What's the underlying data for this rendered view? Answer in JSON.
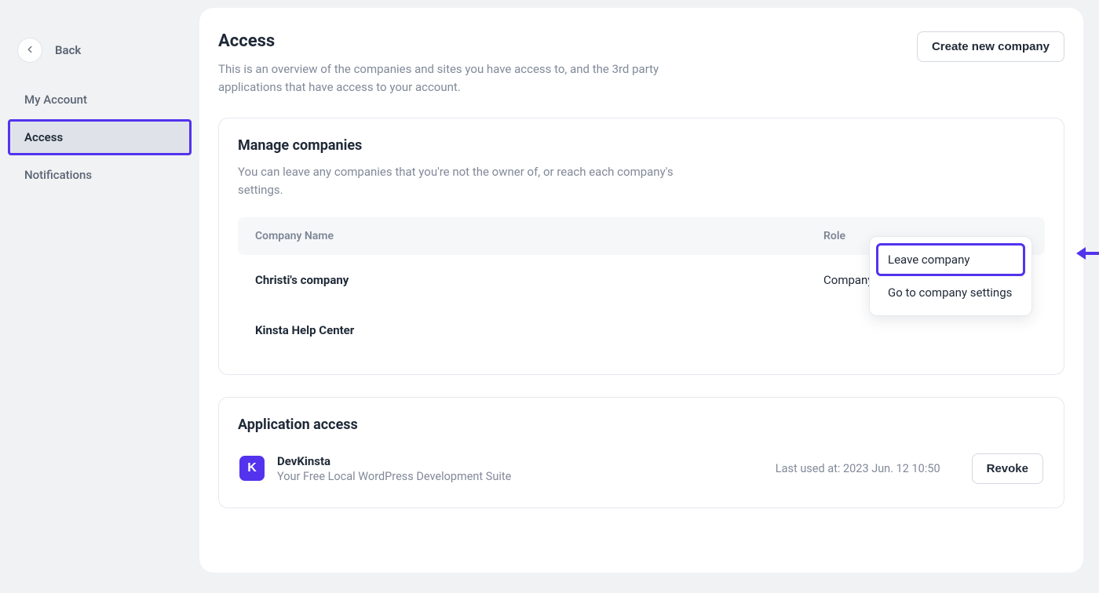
{
  "sidebar": {
    "back_label": "Back",
    "items": [
      {
        "label": "My Account"
      },
      {
        "label": "Access"
      },
      {
        "label": "Notifications"
      }
    ],
    "active_index": 1
  },
  "page": {
    "title": "Access",
    "subtitle": "This is an overview of the companies and sites you have access to, and the 3rd party applications that have access to your account.",
    "create_button": "Create new company"
  },
  "manage_companies": {
    "title": "Manage companies",
    "description": "You can leave any companies that you're not the owner of, or reach each company's settings.",
    "columns": {
      "name": "Company Name",
      "role": "Role"
    },
    "rows": [
      {
        "name": "Christi's company",
        "role": "Company admin"
      },
      {
        "name": "Kinsta Help Center",
        "role": ""
      }
    ],
    "menu": {
      "leave": "Leave company",
      "settings": "Go to company settings"
    }
  },
  "application_access": {
    "title": "Application access",
    "app": {
      "icon_letter": "K",
      "name": "DevKinsta",
      "description": "Your Free Local WordPress Development Suite",
      "last_used": "Last used at: 2023 Jun. 12 10:50",
      "revoke": "Revoke"
    }
  },
  "annotation": {
    "highlight_color": "#5333ed"
  }
}
